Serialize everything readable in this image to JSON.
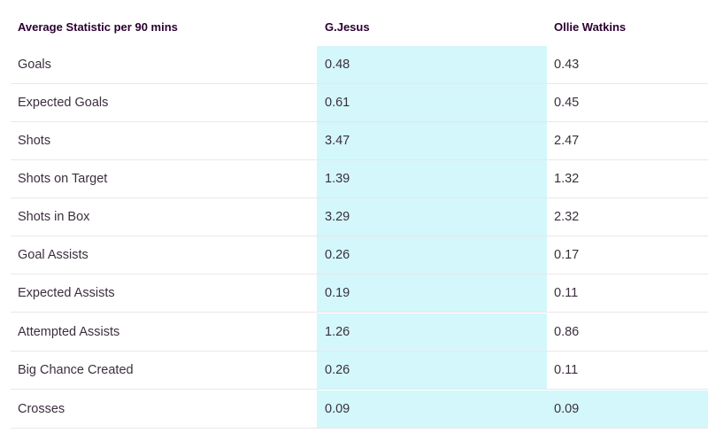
{
  "header": {
    "stat_label": "Average Statistic per 90 mins",
    "player1": "G.Jesus",
    "player2": "Ollie Watkins"
  },
  "rows": [
    {
      "stat": "Goals",
      "p1": "0.48",
      "p2": "0.43",
      "p1_highlight": true,
      "p2_highlight": false
    },
    {
      "stat": "Expected Goals",
      "p1": "0.61",
      "p2": "0.45",
      "p1_highlight": true,
      "p2_highlight": false
    },
    {
      "stat": "Shots",
      "p1": "3.47",
      "p2": "2.47",
      "p1_highlight": true,
      "p2_highlight": false
    },
    {
      "stat": "Shots on Target",
      "p1": "1.39",
      "p2": "1.32",
      "p1_highlight": true,
      "p2_highlight": false
    },
    {
      "stat": "Shots in Box",
      "p1": "3.29",
      "p2": "2.32",
      "p1_highlight": true,
      "p2_highlight": false
    },
    {
      "stat": "Goal Assists",
      "p1": "0.26",
      "p2": "0.17",
      "p1_highlight": true,
      "p2_highlight": false
    },
    {
      "stat": "Expected Assists",
      "p1": "0.19",
      "p2": "0.11",
      "p1_highlight": true,
      "p2_highlight": false
    },
    {
      "stat": "Attempted Assists",
      "p1": "1.26",
      "p2": "0.86",
      "p1_highlight": true,
      "p2_highlight": false
    },
    {
      "stat": "Big Chance Created",
      "p1": "0.26",
      "p2": "0.11",
      "p1_highlight": true,
      "p2_highlight": false
    },
    {
      "stat": "Crosses",
      "p1": "0.09",
      "p2": "0.09",
      "p1_highlight": true,
      "p2_highlight": true
    }
  ],
  "colors": {
    "highlight": "#d3f7fb",
    "text": "#3b2f3d",
    "header_text": "#2a0030",
    "divider": "#ebe5eb"
  }
}
